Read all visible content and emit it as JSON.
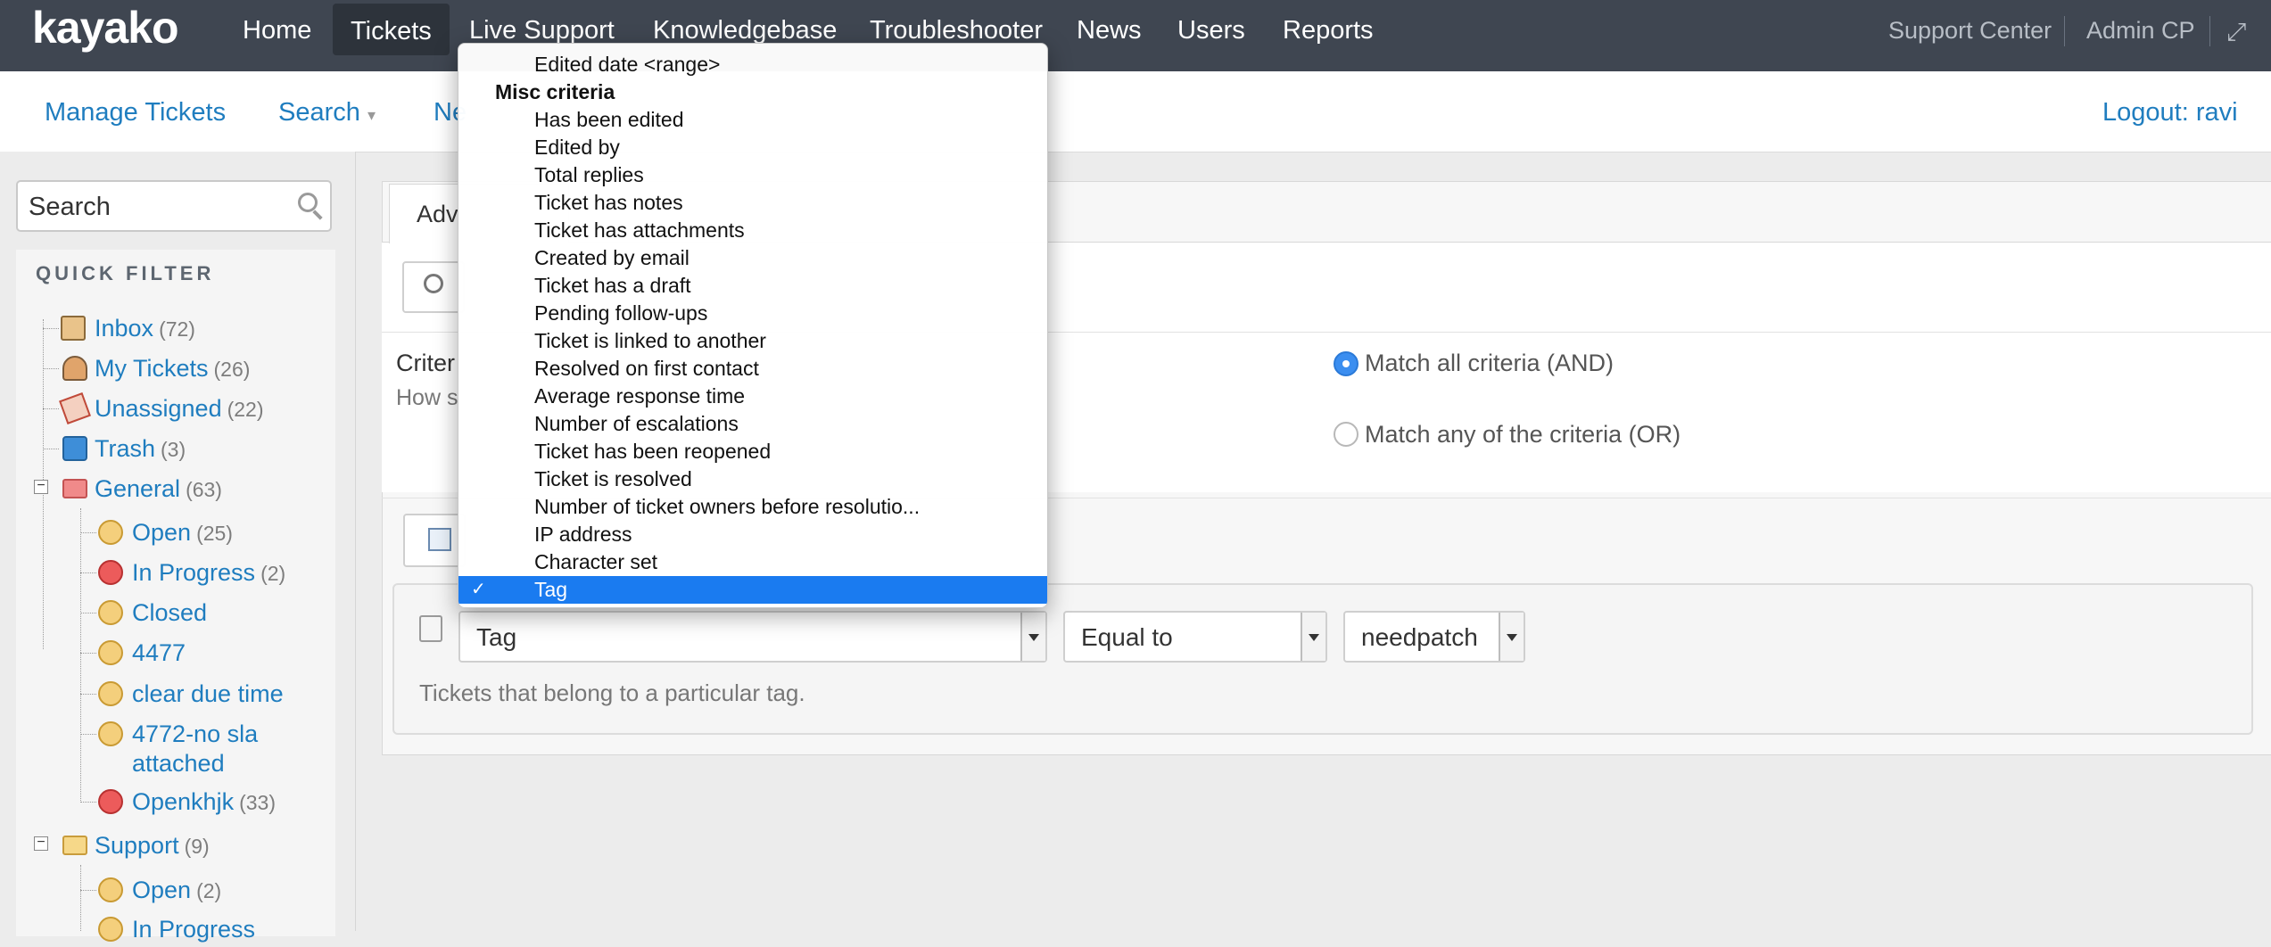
{
  "topnav": {
    "logo": "kayako",
    "items": [
      "Home",
      "Tickets",
      "Live Support",
      "Knowledgebase",
      "Troubleshooter",
      "News",
      "Users",
      "Reports"
    ],
    "active": "Tickets",
    "right": [
      "Support Center",
      "Admin CP"
    ]
  },
  "subnav": {
    "manage": "Manage Tickets",
    "search": "Search",
    "new_partial": "Ne",
    "logout": "Logout: ravi"
  },
  "sidebar": {
    "search_placeholder": "Search",
    "quick_filter": "QUICK FILTER",
    "items": [
      {
        "label": "Inbox",
        "count": "(72)",
        "icon": "inbox-icon"
      },
      {
        "label": "My Tickets",
        "count": "(26)",
        "icon": "user-icon"
      },
      {
        "label": "Unassigned",
        "count": "(22)",
        "icon": "unassigned-icon"
      },
      {
        "label": "Trash",
        "count": "(3)",
        "icon": "trash-icon"
      }
    ],
    "general": {
      "label": "General",
      "count": "(63)",
      "children": [
        {
          "label": "Open",
          "count": "(25)",
          "status": "yellow"
        },
        {
          "label": "In Progress",
          "count": "(2)",
          "status": "red"
        },
        {
          "label": "Closed",
          "count": "",
          "status": "yellow"
        },
        {
          "label": "4477",
          "count": "",
          "status": "yellow"
        },
        {
          "label": "clear due time",
          "count": "",
          "status": "yellow"
        },
        {
          "label": "4772-no sla",
          "label2": "attached",
          "count": "",
          "status": "yellow"
        },
        {
          "label": "Openkhjk",
          "count": "(33)",
          "status": "red"
        }
      ]
    },
    "support": {
      "label": "Support",
      "count": "(9)",
      "children": [
        {
          "label": "Open",
          "count": "(2)",
          "status": "yellow"
        },
        {
          "label": "In Progress",
          "count": "",
          "status": "yellow"
        }
      ]
    }
  },
  "main": {
    "tab_partial": "Adv",
    "criteria_partial": "Criter",
    "how_partial": "How s",
    "match_all": "Match all criteria (AND)",
    "match_any": "Match any of the criteria (OR)",
    "field_select": "Tag",
    "operator_select": "Equal to",
    "value_select": "needpatch",
    "description": "Tickets that belong to a particular tag."
  },
  "dropdown": {
    "top_item": "Edited date <range>",
    "group": "Misc criteria",
    "items": [
      "Has been edited",
      "Edited by",
      "Total replies",
      "Ticket has notes",
      "Ticket has attachments",
      "Created by email",
      "Ticket has a draft",
      "Pending follow-ups",
      "Ticket is linked to another",
      "Resolved on first contact",
      "Average response time",
      "Number of escalations",
      "Ticket has been reopened",
      "Ticket is resolved",
      "Number of ticket owners before resolutio...",
      "IP address",
      "Character set",
      "Tag"
    ],
    "selected": "Tag",
    "check": "✓"
  },
  "colors": {
    "topbar": "#3f4651",
    "link": "#1f7dbf",
    "selected": "#1a7bf0"
  }
}
